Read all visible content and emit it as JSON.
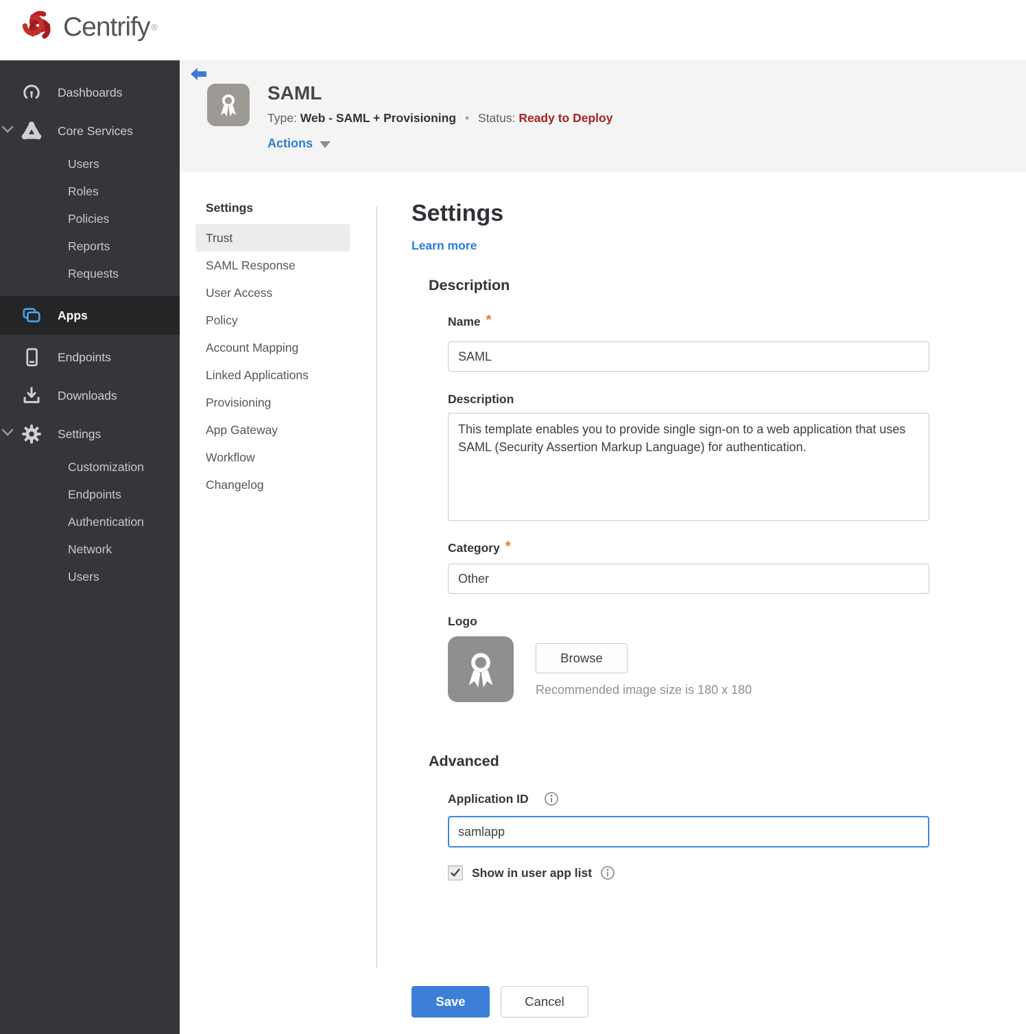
{
  "brand": {
    "name": "Centrify",
    "registered": "®"
  },
  "colors": {
    "accent_blue": "#3c7fd9",
    "brand_red": "#b92025",
    "status_red": "#a32421",
    "required_orange": "#e8782a",
    "sidebar_bg": "#343639",
    "sidebar_active_bg": "#232527",
    "header_band_bg": "#f4f4f4",
    "subnav_active_bg": "#ececec"
  },
  "sidebar": {
    "items": [
      {
        "label": "Dashboards",
        "icon": "gauge-icon",
        "level": "top"
      },
      {
        "label": "Core Services",
        "icon": "core-services-icon",
        "level": "top",
        "expanded": true
      },
      {
        "label": "Users",
        "level": "sub"
      },
      {
        "label": "Roles",
        "level": "sub"
      },
      {
        "label": "Policies",
        "level": "sub"
      },
      {
        "label": "Reports",
        "level": "sub"
      },
      {
        "label": "Requests",
        "level": "sub"
      },
      {
        "label": "Apps",
        "icon": "apps-icon",
        "level": "top",
        "active": true
      },
      {
        "label": "Endpoints",
        "icon": "endpoint-icon",
        "level": "top"
      },
      {
        "label": "Downloads",
        "icon": "download-icon",
        "level": "top"
      },
      {
        "label": "Settings",
        "icon": "gear-icon",
        "level": "top",
        "expanded": true
      },
      {
        "label": "Customization",
        "level": "sub"
      },
      {
        "label": "Endpoints",
        "level": "sub"
      },
      {
        "label": "Authentication",
        "level": "sub"
      },
      {
        "label": "Network",
        "level": "sub"
      },
      {
        "label": "Users",
        "level": "sub"
      }
    ]
  },
  "app_header": {
    "title": "SAML",
    "type_label": "Type:",
    "type_value": "Web - SAML + Provisioning",
    "separator": "•",
    "status_label": "Status:",
    "status_value": "Ready to Deploy",
    "actions_label": "Actions"
  },
  "subnav": {
    "header": "Settings",
    "active": "Trust",
    "items": [
      "Trust",
      "SAML Response",
      "User Access",
      "Policy",
      "Account Mapping",
      "Linked Applications",
      "Provisioning",
      "App Gateway",
      "Workflow",
      "Changelog"
    ]
  },
  "main": {
    "title": "Settings",
    "learn_more": "Learn more",
    "description_section": {
      "heading": "Description",
      "name_label": "Name",
      "required_mark": "*",
      "name_value": "SAML",
      "description_label": "Description",
      "description_value": "This template enables you to provide single sign-on to a web application that uses SAML (Security Assertion Markup Language) for authentication.",
      "category_label": "Category",
      "category_value": "Other",
      "logo_label": "Logo",
      "browse_label": "Browse",
      "logo_hint": "Recommended image size is 180 x 180"
    },
    "advanced_section": {
      "heading": "Advanced",
      "application_id_label": "Application ID",
      "application_id_value": "samlapp",
      "show_in_user_app_list_label": "Show in user app list",
      "checkbox_checked": true
    },
    "footer": {
      "save_label": "Save",
      "cancel_label": "Cancel"
    }
  }
}
